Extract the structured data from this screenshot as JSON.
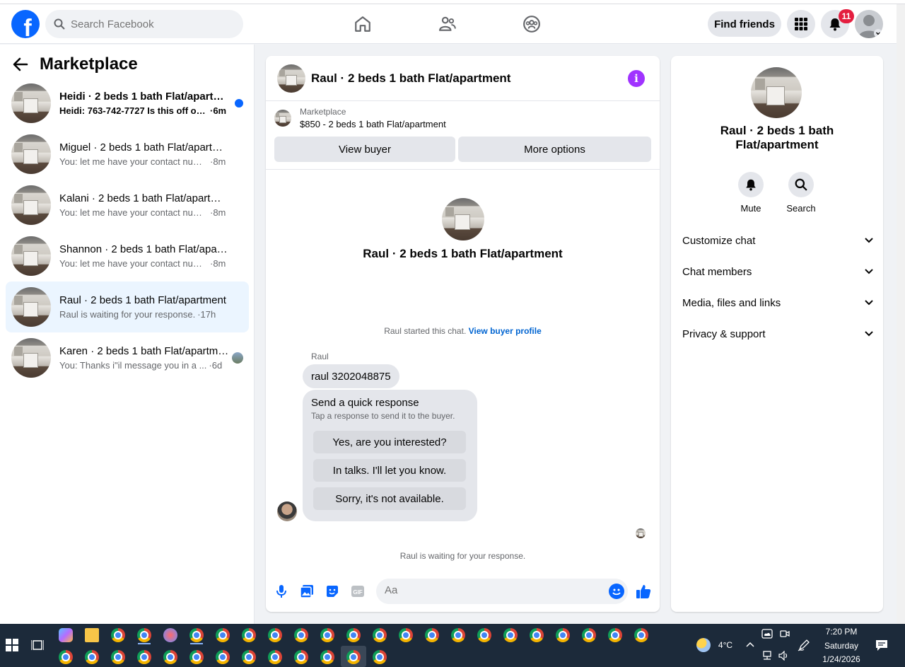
{
  "topbar": {
    "search_placeholder": "Search Facebook",
    "find_friends_label": "Find friends",
    "notification_count": "11",
    "logo_letter": "f"
  },
  "sidebar": {
    "title": "Marketplace",
    "conversations": [
      {
        "name": "Heidi · 2 beds 1 bath Flat/apartment",
        "message": "Heidi: 763-742-7727 Is this off of ...",
        "time": "·6m",
        "unread": true
      },
      {
        "name": "Miguel · 2 beds 1 bath Flat/apartment",
        "message": "You: let me have your contact numbe...",
        "time": "·8m",
        "unread": false
      },
      {
        "name": "Kalani · 2 beds 1 bath Flat/apartment",
        "message": "You: let me have your contact numbe...",
        "time": "·8m",
        "unread": false
      },
      {
        "name": "Shannon · 2 beds 1 bath Flat/apartment",
        "message": "You: let me have your contact numbe...",
        "time": "·8m",
        "unread": false
      },
      {
        "name": "Raul · 2 beds 1 bath Flat/apartment",
        "message": "Raul is waiting for your response.",
        "time": "·17h",
        "unread": false,
        "active": true
      },
      {
        "name": "Karen · 2 beds 1 bath Flat/apartment",
        "message": "You: Thanks i\"il message you in a ...",
        "time": "·6d",
        "unread": false
      }
    ]
  },
  "chat": {
    "header_name": "Raul · 2 beds 1 bath Flat/apartment",
    "listing_label": "Marketplace",
    "listing_price": "$850 - 2 beds 1 bath Flat/apartment",
    "view_buyer_label": "View buyer",
    "more_options_label": "More options",
    "center_name": "Raul · 2 beds 1 bath Flat/apartment",
    "started_text": "Raul started this chat.",
    "view_buyer_profile": "View buyer profile",
    "sender": "Raul",
    "message": "raul 3202048875",
    "quick_response_title": "Send a quick response",
    "quick_response_subtitle": "Tap a response to send it to the buyer.",
    "quick_responses": [
      "Yes, are you interested?",
      "In talks. I'll let you know.",
      "Sorry, it's not available."
    ],
    "waiting_text": "Raul is waiting for your response.",
    "composer_placeholder": "Aa",
    "accent_color": "#0866ff"
  },
  "right_panel": {
    "name": "Raul · 2 beds 1 bath Flat/apartment",
    "mute_label": "Mute",
    "search_label": "Search",
    "sections": [
      "Customize chat",
      "Chat members",
      "Media, files and links",
      "Privacy & support"
    ]
  },
  "taskbar": {
    "temperature": "4°C",
    "time": "7:20 PM",
    "day": "Saturday",
    "date": "1/24/2026"
  }
}
